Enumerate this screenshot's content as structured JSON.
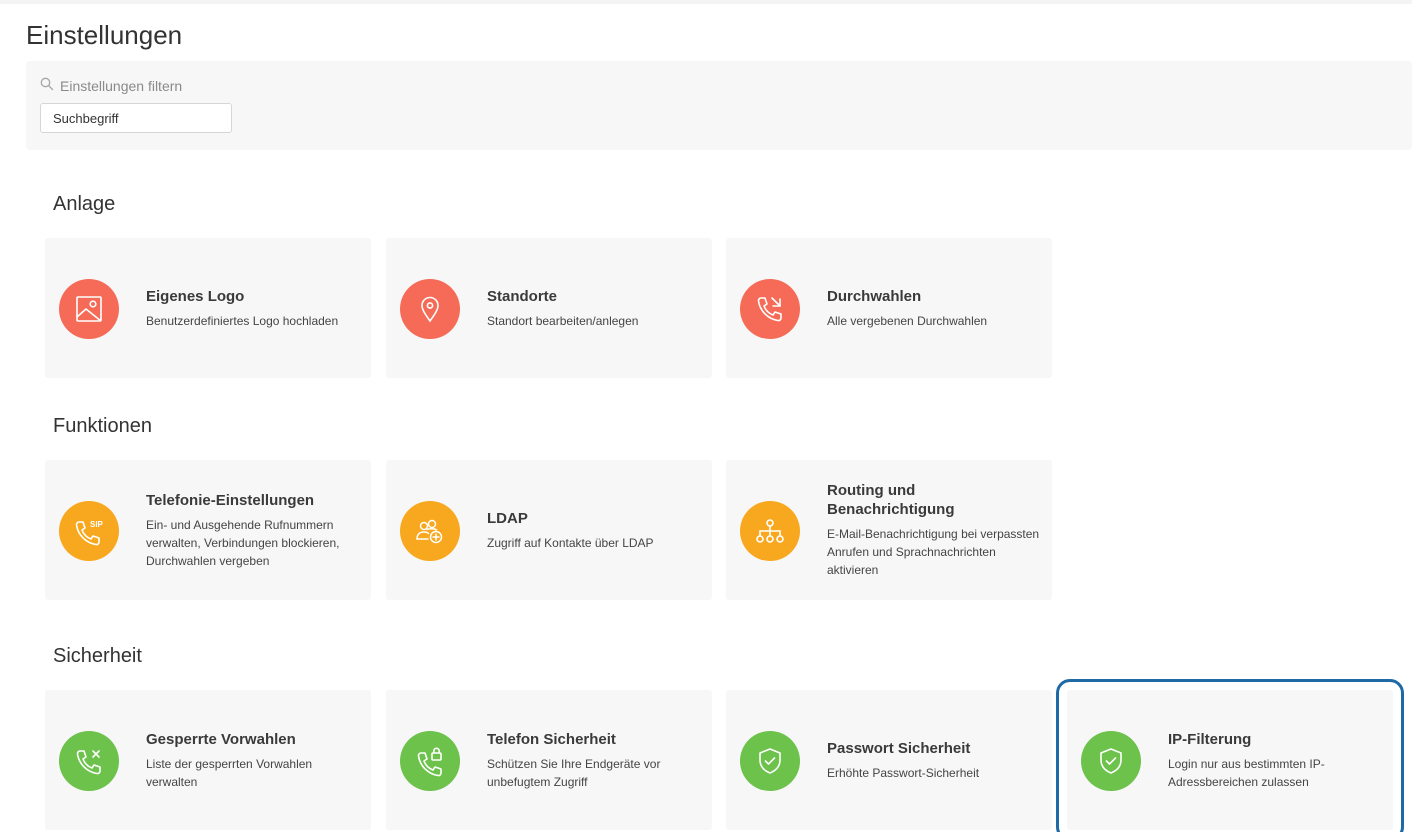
{
  "page": {
    "title": "Einstellungen"
  },
  "filter": {
    "label": "Einstellungen filtern",
    "placeholder": "Suchbegriff"
  },
  "colors": {
    "anlage": "#f56b57",
    "funktionen": "#f8a81e",
    "sicherheit": "#6cc24a",
    "selection": "#1f6aa5"
  },
  "sections": [
    {
      "title": "Anlage",
      "cards": [
        {
          "title": "Eigenes Logo",
          "desc": "Benutzerdefiniertes Logo hochladen",
          "icon": "image-icon"
        },
        {
          "title": "Standorte",
          "desc": "Standort bearbeiten/anlegen",
          "icon": "location-pin-icon"
        },
        {
          "title": "Durchwahlen",
          "desc": "Alle vergebenen Durchwahlen",
          "icon": "phone-forward-icon"
        }
      ]
    },
    {
      "title": "Funktionen",
      "cards": [
        {
          "title": "Telefonie-Einstellungen",
          "desc": "Ein- und Ausgehende Rufnummern verwalten, Verbindungen blockieren, Durchwahlen vergeben",
          "icon": "sip-phone-icon",
          "icon_text": "SIP"
        },
        {
          "title": "LDAP",
          "desc": "Zugriff auf Kontakte über LDAP",
          "icon": "users-add-icon"
        },
        {
          "title": "Routing und Benachrichtigung",
          "desc": "E-Mail-Benachrichtigung bei verpassten Anrufen und Sprachnachrichten aktivieren",
          "icon": "hierarchy-icon"
        }
      ]
    },
    {
      "title": "Sicherheit",
      "cards": [
        {
          "title": "Gesperrte Vorwahlen",
          "desc": "Liste der gesperrten Vorwahlen verwalten",
          "icon": "phone-blocked-icon"
        },
        {
          "title": "Telefon Sicherheit",
          "desc": "Schützen Sie Ihre Endgeräte vor unbefugtem Zugriff",
          "icon": "phone-lock-icon"
        },
        {
          "title": "Passwort Sicherheit",
          "desc": "Erhöhte Passwort-Sicherheit",
          "icon": "shield-check-icon"
        },
        {
          "title": "IP-Filterung",
          "desc": "Login nur aus bestimmten IP-Adressbereichen zulassen",
          "icon": "shield-check-icon",
          "selected": true
        }
      ]
    }
  ]
}
